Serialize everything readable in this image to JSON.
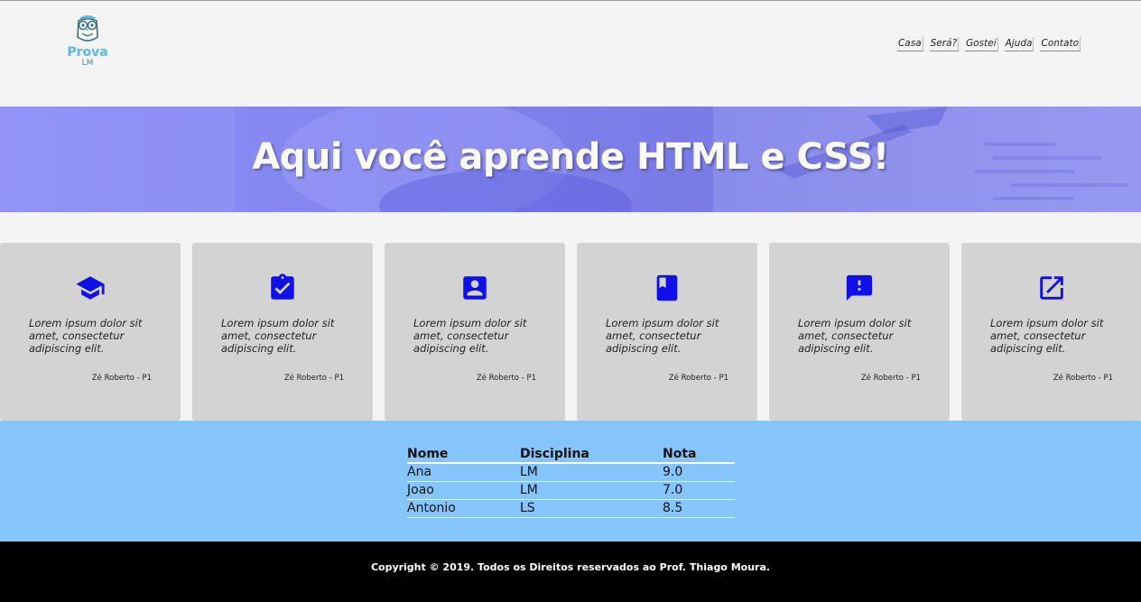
{
  "header": {
    "logo": {
      "title": "Prova",
      "subtitle": "LM",
      "icon": "owl-icon"
    },
    "nav": [
      {
        "label": "Casa"
      },
      {
        "label": "Será?"
      },
      {
        "label": "Gostei"
      },
      {
        "label": "Ajuda"
      },
      {
        "label": "Contato"
      }
    ]
  },
  "hero": {
    "title": "Aqui você aprende HTML e CSS!"
  },
  "cards": [
    {
      "icon": "graduation-cap-icon",
      "text": "Lorem ipsum dolor sit amet, consectetur adipiscing elit.",
      "author": "Zé Roberto - P1"
    },
    {
      "icon": "clipboard-check-icon",
      "text": "Lorem ipsum dolor sit amet, consectetur adipiscing elit.",
      "author": "Zé Roberto - P1"
    },
    {
      "icon": "account-box-icon",
      "text": "Lorem ipsum dolor sit amet, consectetur adipiscing elit.",
      "author": "Zé Roberto - P1"
    },
    {
      "icon": "book-icon",
      "text": "Lorem ipsum dolor sit amet, consectetur adipiscing elit.",
      "author": "Zé Roberto - P1"
    },
    {
      "icon": "feedback-icon",
      "text": "Lorem ipsum dolor sit amet, consectetur adipiscing elit.",
      "author": "Zé Roberto - P1"
    },
    {
      "icon": "open-in-new-icon",
      "text": "Lorem ipsum dolor sit amet, consectetur adipiscing elit.",
      "author": "Zé Roberto - P1"
    }
  ],
  "grades": {
    "headers": [
      "Nome",
      "Disciplina",
      "Nota"
    ],
    "rows": [
      [
        "Ana",
        "LM",
        "9.0"
      ],
      [
        "Joao",
        "LM",
        "7.0"
      ],
      [
        "Antonio",
        "LS",
        "8.5"
      ]
    ]
  },
  "footer": {
    "text": "Copyright © 2019. Todos os Direitos reservados ao Prof. Thiago Moura."
  },
  "colors": {
    "icon_blue": "#1010e8",
    "grades_bg": "#85c5fb",
    "hero_tint": "#8384ef",
    "logo_blue": "#5bb8e6"
  }
}
